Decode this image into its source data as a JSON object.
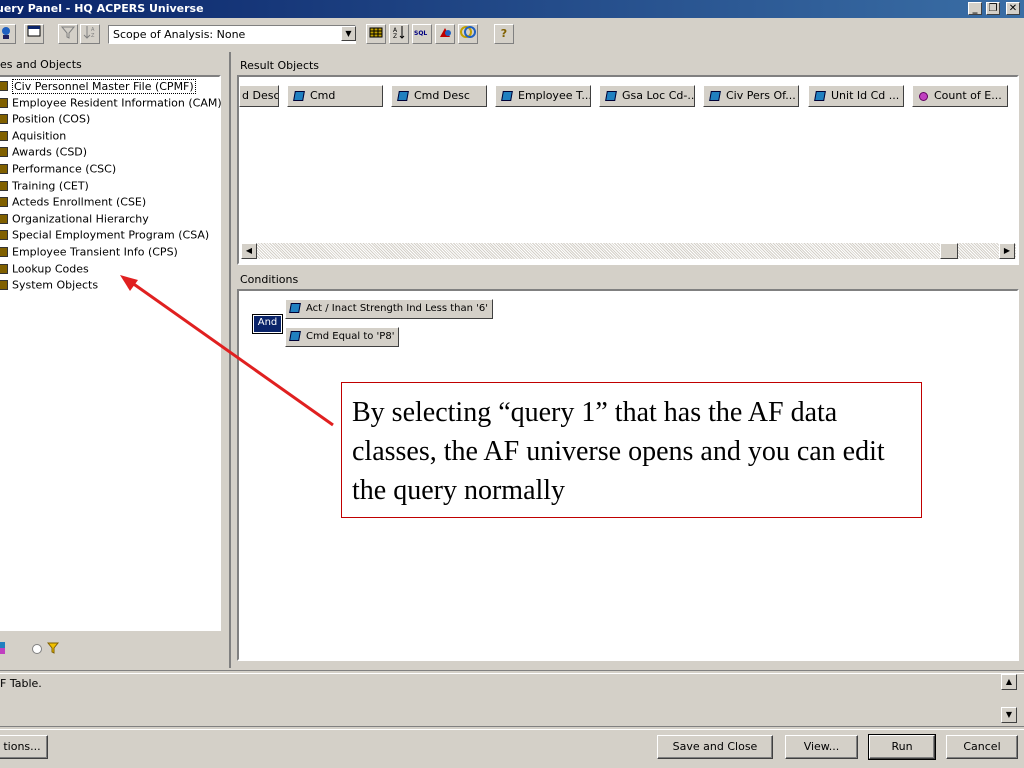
{
  "window": {
    "title": "uery Panel - HQ ACPERS Universe",
    "minimize": "_",
    "maximize": "❐",
    "close": "✕"
  },
  "toolbar": {
    "scope_value": "Scope of Analysis: None",
    "help": "?"
  },
  "left_panel": {
    "title": "es and Objects",
    "classes": [
      "Civ Personnel Master File (CPMF)",
      "Employee Resident Information (CAM)",
      "Position (COS)",
      "Aquisition",
      "Awards (CSD)",
      "Performance (CSC)",
      "Training (CET)",
      "Acteds Enrollment (CSE)",
      "Organizational Hierarchy",
      "Special Employment Program (CSA)",
      "Employee Transient Info (CPS)",
      "Lookup Codes",
      "System Objects"
    ]
  },
  "result_objects": {
    "title": "Result Objects",
    "items": [
      "d Desc",
      "Cmd",
      "Cmd Desc",
      "Employee T...",
      "Gsa Loc Cd-...",
      "Civ Pers Of...",
      "Unit Id Cd ...",
      "Count of E..."
    ]
  },
  "conditions": {
    "title": "Conditions",
    "operator": "And",
    "items": [
      "Act / Inact Strength Ind Less than '6'",
      "Cmd Equal to 'P8'"
    ]
  },
  "status": {
    "text": "F Table."
  },
  "buttons": {
    "options": "tions...",
    "save_close": "Save and Close",
    "view": "View...",
    "run": "Run",
    "cancel": "Cancel"
  },
  "callout": {
    "text": "By selecting “query 1” that has the AF data classes, the AF universe opens and you can edit the query normally"
  },
  "colors": {
    "title_bar": "#0a246a",
    "arrow": "#e02020",
    "callout_border": "#c00000"
  }
}
